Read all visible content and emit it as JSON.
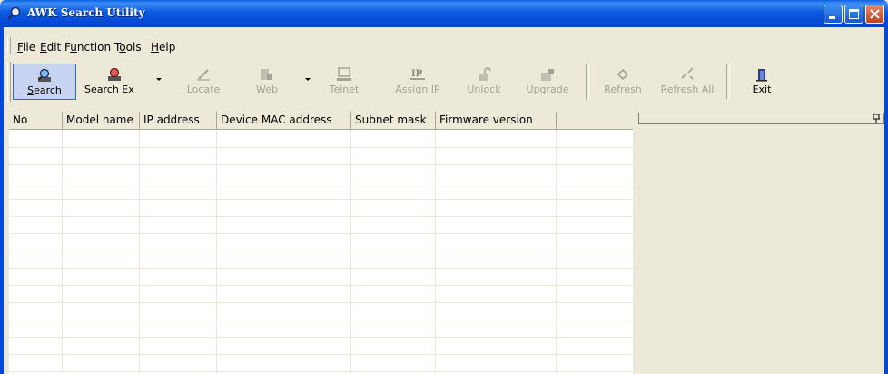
{
  "window": {
    "title": "AWK Search Utility",
    "app_icon": "magnifier-icon",
    "controls": [
      "minimize-icon",
      "maximize-icon",
      "close-icon"
    ]
  },
  "menu": {
    "items": [
      {
        "label": "File",
        "mnemonic": "F"
      },
      {
        "label": "Edit",
        "mnemonic": "E"
      },
      {
        "label": "Function",
        "mnemonic": "u"
      },
      {
        "label": "Tools",
        "mnemonic": "o"
      },
      {
        "label": "Help",
        "mnemonic": "H"
      }
    ]
  },
  "toolbar": {
    "search": {
      "label": "Search",
      "icon": "search-device-icon",
      "enabled": true,
      "active": true
    },
    "search_ex": {
      "label": "Search Ex",
      "icon": "search-ex-icon",
      "enabled": true
    },
    "locate": {
      "label": "Locate",
      "icon": "locate-icon",
      "enabled": false
    },
    "web": {
      "label": "Web",
      "icon": "web-icon",
      "enabled": false
    },
    "telnet": {
      "label": "Telnet",
      "icon": "telnet-icon",
      "enabled": false
    },
    "assign_ip": {
      "label": "Assign IP",
      "icon": "assign-ip-icon",
      "enabled": false
    },
    "unlock": {
      "label": "Unlock",
      "icon": "unlock-icon",
      "enabled": false
    },
    "upgrade": {
      "label": "Upgrade",
      "icon": "upgrade-icon",
      "enabled": false
    },
    "refresh": {
      "label": "Refresh",
      "icon": "refresh-icon",
      "enabled": false
    },
    "refresh_all": {
      "label": "Refresh All",
      "icon": "refresh-all-icon",
      "enabled": false
    },
    "exit": {
      "label": "Exit",
      "icon": "exit-icon",
      "enabled": true
    }
  },
  "table": {
    "columns": [
      "No",
      "Model name",
      "IP address",
      "Device MAC address",
      "Subnet mask",
      "Firmware version",
      ""
    ],
    "rows": []
  },
  "side_panel": {
    "pin_icon": "pin-icon"
  },
  "colors": {
    "titlebar": "#0349d6",
    "chrome": "#ece9d8",
    "active_button": "#c6d3f1",
    "disabled_text": "#a5a195"
  }
}
